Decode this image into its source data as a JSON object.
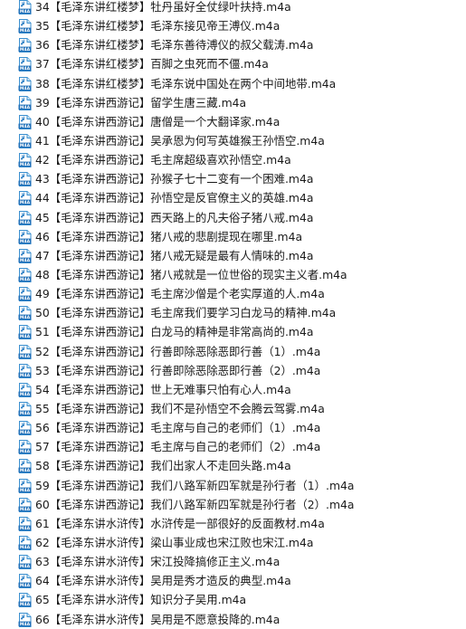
{
  "icon": {
    "name": "m4a-audio-file-icon",
    "text": "M4A",
    "colors": {
      "page": "#ffffff",
      "fold": "#cfe8f7",
      "outline": "#3a8fcf",
      "band": "#1f6fb8",
      "band_text": "#ffffff",
      "glyph": "#2b7ec4"
    }
  },
  "files": [
    {
      "name": "34【毛泽东讲红楼梦】牡丹虽好全仗绿叶扶持.m4a"
    },
    {
      "name": "35【毛泽东讲红楼梦】毛泽东接见帝王溥仪.m4a"
    },
    {
      "name": "36【毛泽东讲红楼梦】毛泽东善待溥仪的叔父载涛.m4a"
    },
    {
      "name": "37【毛泽东讲红楼梦】百脚之虫死而不僵.m4a"
    },
    {
      "name": "38【毛泽东讲红楼梦】毛泽东说中国处在两个中间地带.m4a"
    },
    {
      "name": "39【毛泽东讲西游记】留学生唐三藏.m4a"
    },
    {
      "name": "40【毛泽东讲西游记】唐僧是一个大翻译家.m4a"
    },
    {
      "name": "41【毛泽东讲西游记】吴承恩为何写英雄猴王孙悟空.m4a"
    },
    {
      "name": "42【毛泽东讲西游记】毛主席超级喜欢孙悟空.m4a"
    },
    {
      "name": "43【毛泽东讲西游记】孙猴子七十二变有一个困难.m4a"
    },
    {
      "name": "44【毛泽东讲西游记】孙悟空是反官僚主义的英雄.m4a"
    },
    {
      "name": "45【毛泽东讲西游记】西天路上的凡夫俗子猪八戒.m4a"
    },
    {
      "name": "46【毛泽东讲西游记】猪八戒的悲剧提现在哪里.m4a"
    },
    {
      "name": "47【毛泽东讲西游记】猪八戒无疑是最有人情味的.m4a"
    },
    {
      "name": "48【毛泽东讲西游记】猪八戒就是一位世俗的现实主义者.m4a"
    },
    {
      "name": "49【毛泽东讲西游记】毛主席沙僧是个老实厚道的人.m4a"
    },
    {
      "name": "50【毛泽东讲西游记】毛主席我们要学习白龙马的精神.m4a"
    },
    {
      "name": "51【毛泽东讲西游记】白龙马的精神是非常高尚的.m4a"
    },
    {
      "name": "52【毛泽东讲西游记】行善即除恶除恶即行善（1）.m4a"
    },
    {
      "name": "53【毛泽东讲西游记】行善即除恶除恶即行善（2）.m4a"
    },
    {
      "name": "54【毛泽东讲西游记】世上无难事只怕有心人.m4a"
    },
    {
      "name": "55【毛泽东讲西游记】我们不是孙悟空不会腾云驾雾.m4a"
    },
    {
      "name": "56【毛泽东讲西游记】毛主席与自己的老师们（1）.m4a"
    },
    {
      "name": "57【毛泽东讲西游记】毛主席与自己的老师们（2）.m4a"
    },
    {
      "name": "58【毛泽东讲西游记】我们出家人不走回头路.m4a"
    },
    {
      "name": "59【毛泽东讲西游记】我们八路军新四军就是孙行者（1）.m4a"
    },
    {
      "name": "60【毛泽东讲西游记】我们八路军新四军就是孙行者（2）.m4a"
    },
    {
      "name": "61【毛泽东讲水浒传】水浒传是一部很好的反面教材.m4a"
    },
    {
      "name": "62【毛泽东讲水浒传】梁山事业成也宋江败也宋江.m4a"
    },
    {
      "name": "63【毛泽东讲水浒传】宋江投降搞修正主义.m4a"
    },
    {
      "name": "64【毛泽东讲水浒传】吴用是秀才造反的典型.m4a"
    },
    {
      "name": "65【毛泽东讲水浒传】知识分子吴用.m4a"
    },
    {
      "name": "66【毛泽东讲水浒传】吴用是不愿意投降的.m4a"
    }
  ]
}
